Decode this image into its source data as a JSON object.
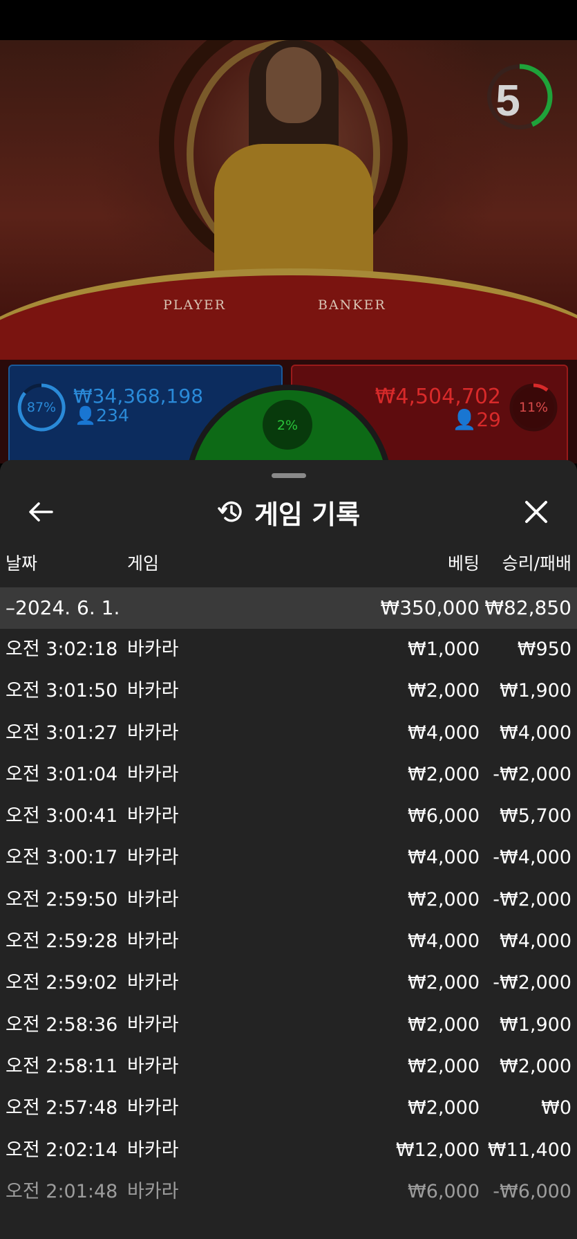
{
  "video": {
    "timer": "5",
    "table_labels": {
      "player": "PLAYER",
      "banker": "BANKER"
    }
  },
  "bets": {
    "player": {
      "percent": "87%",
      "amount": "₩34,368,198",
      "players": "234"
    },
    "tie": {
      "percent": "2%"
    },
    "banker": {
      "percent": "11%",
      "amount": "₩4,504,702",
      "players": "29"
    }
  },
  "colors": {
    "player": "#2a8ad8",
    "banker": "#d82a2a",
    "tie": "#2ac43a",
    "sheet": "#232323"
  },
  "history": {
    "title": "게임 기록",
    "columns": {
      "date": "날짜",
      "game": "게임",
      "bet": "베팅",
      "result": "승리/패배"
    },
    "group": {
      "date": "–2024. 6. 1.",
      "bet_total": "₩350,000",
      "result_total": "₩82,850"
    },
    "rows": [
      {
        "time": "오전 3:02:18",
        "game": "바카라",
        "bet": "₩1,000",
        "result": "₩950"
      },
      {
        "time": "오전 3:01:50",
        "game": "바카라",
        "bet": "₩2,000",
        "result": "₩1,900"
      },
      {
        "time": "오전 3:01:27",
        "game": "바카라",
        "bet": "₩4,000",
        "result": "₩4,000"
      },
      {
        "time": "오전 3:01:04",
        "game": "바카라",
        "bet": "₩2,000",
        "result": "-₩2,000"
      },
      {
        "time": "오전 3:00:41",
        "game": "바카라",
        "bet": "₩6,000",
        "result": "₩5,700"
      },
      {
        "time": "오전 3:00:17",
        "game": "바카라",
        "bet": "₩4,000",
        "result": "-₩4,000"
      },
      {
        "time": "오전 2:59:50",
        "game": "바카라",
        "bet": "₩2,000",
        "result": "-₩2,000"
      },
      {
        "time": "오전 2:59:28",
        "game": "바카라",
        "bet": "₩4,000",
        "result": "₩4,000"
      },
      {
        "time": "오전 2:59:02",
        "game": "바카라",
        "bet": "₩2,000",
        "result": "-₩2,000"
      },
      {
        "time": "오전 2:58:36",
        "game": "바카라",
        "bet": "₩2,000",
        "result": "₩1,900"
      },
      {
        "time": "오전 2:58:11",
        "game": "바카라",
        "bet": "₩2,000",
        "result": "₩2,000"
      },
      {
        "time": "오전 2:57:48",
        "game": "바카라",
        "bet": "₩2,000",
        "result": "₩0"
      },
      {
        "time": "오전 2:02:14",
        "game": "바카라",
        "bet": "₩12,000",
        "result": "₩11,400"
      },
      {
        "time": "오전 2:01:48",
        "game": "바카라",
        "bet": "₩6,000",
        "result": "-₩6,000"
      }
    ]
  }
}
